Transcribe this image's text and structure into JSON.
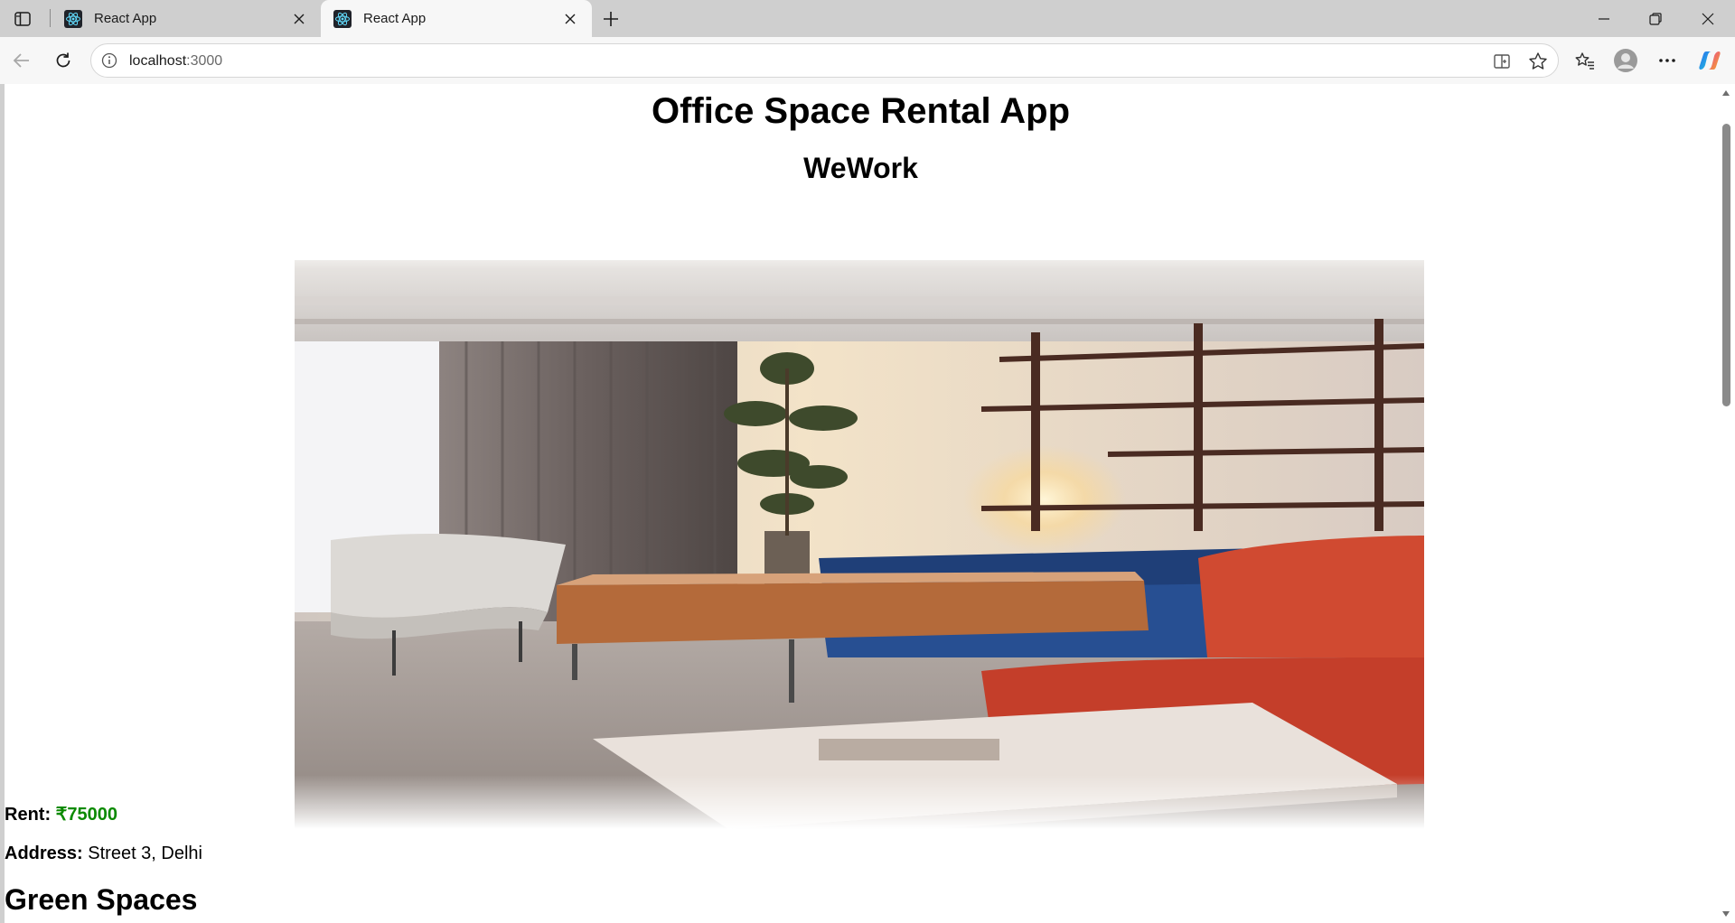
{
  "browser": {
    "tabs": [
      {
        "title": "React App",
        "active": false
      },
      {
        "title": "React App",
        "active": true
      }
    ],
    "url_host": "localhost",
    "url_port": ":3000",
    "icons": {
      "sidebar": "tab-actions-icon",
      "favicon": "react-logo-icon",
      "close": "close-icon",
      "new_tab": "plus-icon",
      "minimize": "minimize-icon",
      "restore": "restore-icon",
      "window_close": "close-icon",
      "back": "back-arrow-icon",
      "refresh": "refresh-icon",
      "info": "info-icon",
      "split_screen": "split-screen-icon",
      "favorite": "star-icon",
      "favorites": "favorites-icon",
      "profile": "profile-icon",
      "more": "more-icon",
      "copilot": "copilot-icon"
    }
  },
  "page": {
    "title": "Office Space Rental App",
    "office": {
      "name": "WeWork",
      "image_subject": "office lounge with sofas, coffee table and shelves",
      "rent_label": "Rent:",
      "rent_value": "₹75000",
      "rent_color": "#0b8a00",
      "address_label": "Address:",
      "address_value": "Street 3, Delhi"
    },
    "next_office_name": "Green Spaces"
  }
}
